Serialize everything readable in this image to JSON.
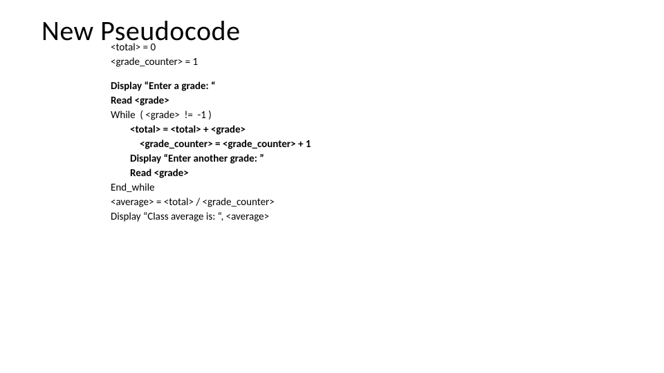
{
  "title": "New Pseudocode",
  "lines": {
    "l1": "<total> = 0",
    "l2": "<grade_counter> = 1",
    "l3": "Display “Enter a grade: “",
    "l4": "Read <grade>",
    "l5": "While  ( <grade>  !=  -1 )",
    "l6": "<total> = <total> + <grade>",
    "l7": "<grade_counter> = <grade_counter> + 1",
    "l8": "Display “Enter another grade: ”",
    "l9": "Read <grade>",
    "l10": "End_while",
    "l11": "<average> = <total> / <grade_counter>",
    "l12": "Display “Class average is: “, <average>"
  }
}
